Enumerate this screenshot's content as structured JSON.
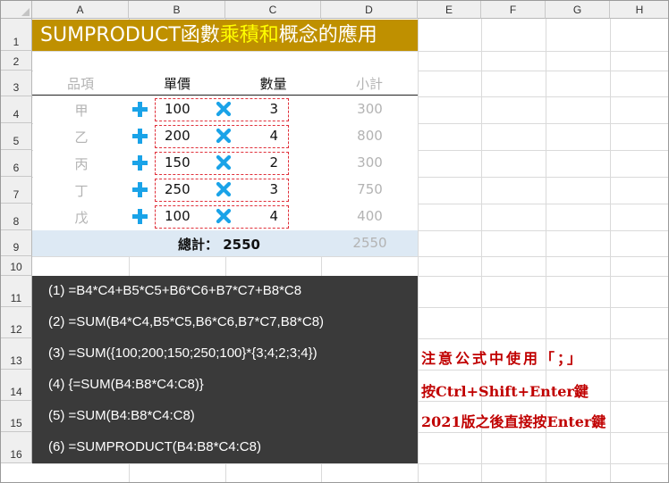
{
  "columns": [
    "A",
    "B",
    "C",
    "D",
    "E",
    "F",
    "G",
    "H"
  ],
  "rows": [
    "1",
    "2",
    "3",
    "4",
    "5",
    "6",
    "7",
    "8",
    "9",
    "10",
    "11",
    "12",
    "13",
    "14",
    "15",
    "16"
  ],
  "title": {
    "prefix": "SUMPRODUCT函數",
    "highlight": "乘積和",
    "suffix": "概念的應用"
  },
  "table": {
    "headers": {
      "item": "品項",
      "price": "單價",
      "qty": "數量",
      "subtotal": "小計"
    },
    "rows": [
      {
        "item": "甲",
        "price": "100",
        "qty": "3",
        "subtotal": "300"
      },
      {
        "item": "乙",
        "price": "200",
        "qty": "4",
        "subtotal": "800"
      },
      {
        "item": "丙",
        "price": "150",
        "qty": "2",
        "subtotal": "300"
      },
      {
        "item": "丁",
        "price": "250",
        "qty": "3",
        "subtotal": "750"
      },
      {
        "item": "戊",
        "price": "100",
        "qty": "4",
        "subtotal": "400"
      }
    ],
    "total_label": "總計： 2550",
    "total_subtotal": "2550"
  },
  "formulas": [
    "(1) =B4*C4+B5*C5+B6*C6+B7*C7+B8*C8",
    "(2) =SUM(B4*C4,B5*C5,B6*C6,B7*C7,B8*C8)",
    "(3) =SUM({100;200;150;250;100}*{3;4;2;3;4})",
    "(4) {=SUM(B4:B8*C4:C8)}",
    "(5) =SUM(B4:B8*C4:C8)",
    "(6) =SUMPRODUCT(B4:B8*C4:C8)"
  ],
  "notes": [
    "注意公式中使用「；」",
    "按Ctrl+Shift+Enter鍵",
    "2021版之後直接按Enter鍵"
  ],
  "icons": {
    "plus": "plus-icon",
    "times": "multiply-icon"
  },
  "colors": {
    "title_bg": "#bf9000",
    "title_highlight": "#ffff00",
    "accent": "#1aa3e8",
    "dashed_box": "#e0303a",
    "note": "#c00000",
    "panel": "#3a3a3a",
    "total_band": "#dde9f4"
  }
}
